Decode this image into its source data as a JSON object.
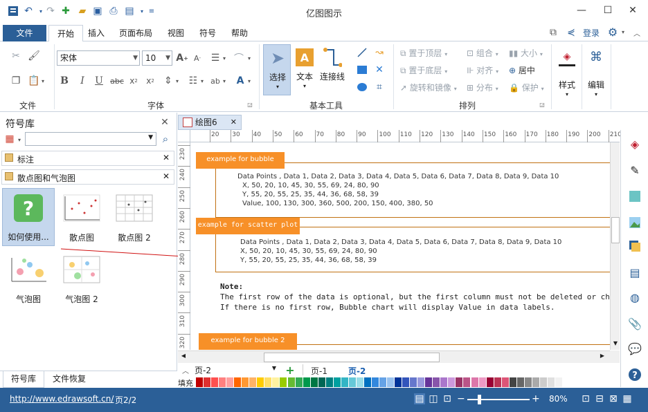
{
  "app": {
    "title": "亿图图示"
  },
  "tabs": [
    "文件",
    "开始",
    "插入",
    "页面布局",
    "视图",
    "符号",
    "帮助"
  ],
  "account": {
    "login": "登录"
  },
  "ribbon": {
    "groups": {
      "file": "文件",
      "font": "字体",
      "basic_tools": "基本工具",
      "arrange": "排列"
    },
    "font": {
      "name": "宋体",
      "size": "10"
    },
    "tools": {
      "select": "选择",
      "text": "文本",
      "connector": "连接线"
    },
    "arrange": {
      "bring_front": "置于顶层",
      "send_back": "置于底层",
      "rotate_mirror": "旋转和镜像",
      "group": "组合",
      "align": "对齐",
      "distribute": "分布",
      "size": "大小",
      "center": "居中",
      "protect": "保护"
    },
    "style": "样式",
    "edit": "编辑"
  },
  "library": {
    "title": "符号库",
    "items": [
      "标注",
      "散点图和气泡图"
    ],
    "thumbs": [
      "如何使用...",
      "散点图",
      "散点图 2",
      "气泡图",
      "气泡图 2"
    ]
  },
  "bottom_tabs": [
    "符号库",
    "文件恢复"
  ],
  "document": {
    "tab": "绘图6"
  },
  "ruler": {
    "h": [
      "20",
      "30",
      "40",
      "50",
      "60",
      "70",
      "80",
      "90",
      "100",
      "110",
      "120",
      "130",
      "140",
      "150",
      "160",
      "170",
      "180",
      "190",
      "200",
      "210"
    ],
    "v": [
      "230",
      "240",
      "250",
      "260",
      "270",
      "280",
      "290",
      "300",
      "310",
      "320"
    ]
  },
  "canvas": {
    "bubble_label": "example for bubble",
    "bubble_lines": [
      "Data Points , Data 1, Data 2, Data 3, Data 4, Data 5, Data 6, Data 7, Data 8, Data 9, Data 10",
      "X, 50, 20, 10, 45, 30, 55, 69, 24, 80, 90",
      "Y, 55, 20, 55, 25, 35, 44, 36, 68, 58, 39",
      "Value, 100, 130, 300, 360, 500, 200, 150, 400, 380, 50"
    ],
    "scatter_label": "example for scatter plot",
    "scatter_lines": [
      "Data Points , Data 1, Data 2, Data 3, Data 4, Data 5, Data 6, Data 7, Data 8, Data 9, Data 10",
      "X, 50, 20, 10, 45, 30, 55, 69, 24, 80, 90",
      "Y, 55, 20, 55, 25, 35, 44, 36, 68, 58, 39"
    ],
    "note_title": "Note:",
    "note_lines": [
      "The first row of the data is optional, but the first column must not be deleted or chang",
      "If there is no first row, Bubble chart will display Value in data labels."
    ],
    "bubble2_label": "example for bubble 2"
  },
  "pagebar": {
    "current": "页-2",
    "pages": [
      "页-1",
      "页-2"
    ]
  },
  "fill_label": "填充",
  "status": {
    "url": "http://www.edrawsoft.cn/",
    "page": "页2/2",
    "zoom": "80%"
  },
  "colors": {
    "accent": "#2b5f97",
    "orange": "#f79028"
  },
  "palette": [
    "#c00000",
    "#e03030",
    "#ff5050",
    "#ff8080",
    "#ffa0a0",
    "#ff6600",
    "#ff9933",
    "#ffb366",
    "#ffcc00",
    "#ffe066",
    "#fff2a0",
    "#99cc00",
    "#66bb33",
    "#33aa55",
    "#00994c",
    "#007744",
    "#006655",
    "#008080",
    "#00a0a0",
    "#33b5c5",
    "#66c8d8",
    "#99dde8",
    "#0070c0",
    "#3388dd",
    "#66a3e6",
    "#99c2ef",
    "#003399",
    "#3355bb",
    "#6677cc",
    "#9999dd",
    "#663399",
    "#8855aa",
    "#aa77cc",
    "#cc99dd",
    "#993366",
    "#bb5588",
    "#dd77aa",
    "#ee99c4",
    "#990033",
    "#bb3355",
    "#dd5577",
    "#444444",
    "#666666",
    "#888888",
    "#aaaaaa",
    "#cccccc",
    "#e0e0e0",
    "#f2f2f2"
  ]
}
